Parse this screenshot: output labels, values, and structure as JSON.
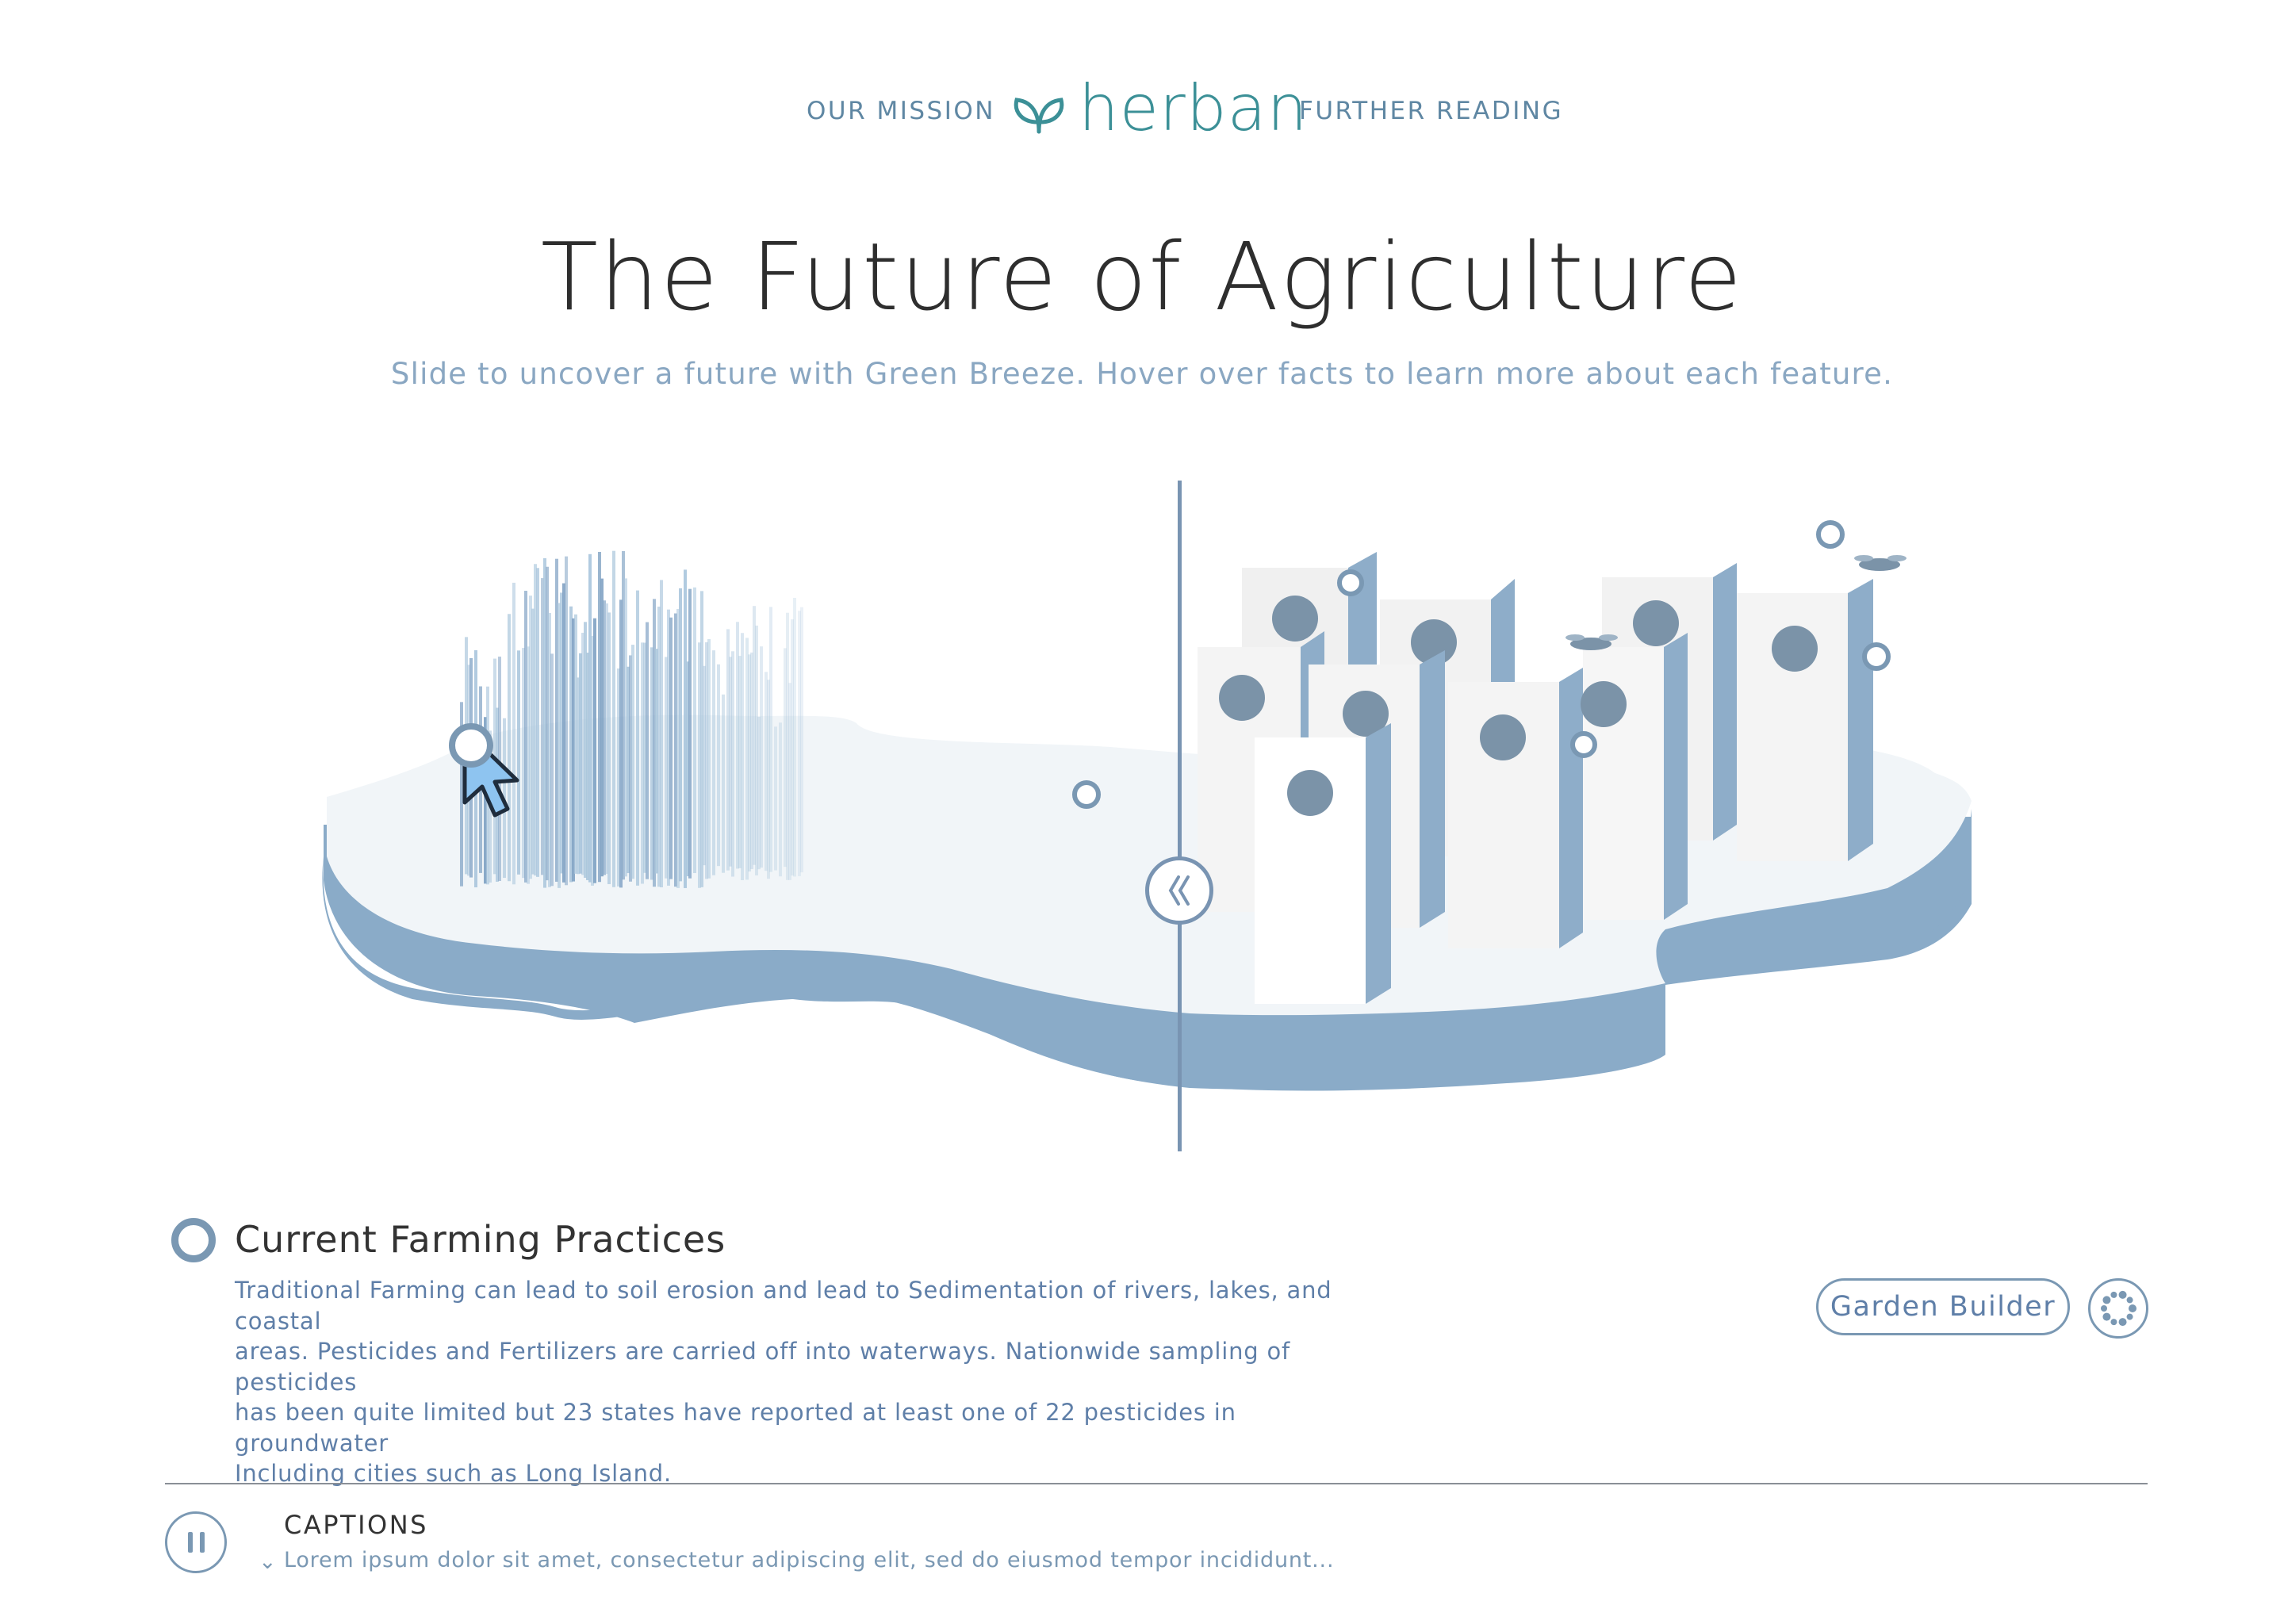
{
  "nav": {
    "left_link": "OUR MISSION",
    "brand": "herban",
    "right_link": "FURTHER READING"
  },
  "hero": {
    "title": "The Future of Agriculture",
    "subtitle": "Slide to uncover a future with Green Breeze. Hover over facts to learn more about each feature."
  },
  "info": {
    "title": "Current Farming Practices",
    "lines": [
      "Traditional Farming can lead to soil erosion and lead to Sedimentation of rivers, lakes, and coastal",
      "areas. Pesticides and Fertilizers are carried off into waterways. Nationwide sampling of pesticides",
      "has been quite limited but 23 states have reported at least one of 22 pesticides in groundwater",
      "Including cities such as Long Island."
    ]
  },
  "actions": {
    "garden_builder": "Garden Builder"
  },
  "captions": {
    "label": "CAPTIONS",
    "toggle_icon": "chevron-down-icon",
    "text": "Lorem ipsum dolor sit amet, consectetur adipiscing elit, sed do eiusmod tempor incididunt..."
  },
  "colors": {
    "accent": "#7a98b3",
    "brand": "#3c9097",
    "map_top": "#f1f5f8",
    "map_side": "#8aabc8",
    "building": "#f4f4f4",
    "building_side": "#8eadc9",
    "window": "#7b93a8"
  }
}
